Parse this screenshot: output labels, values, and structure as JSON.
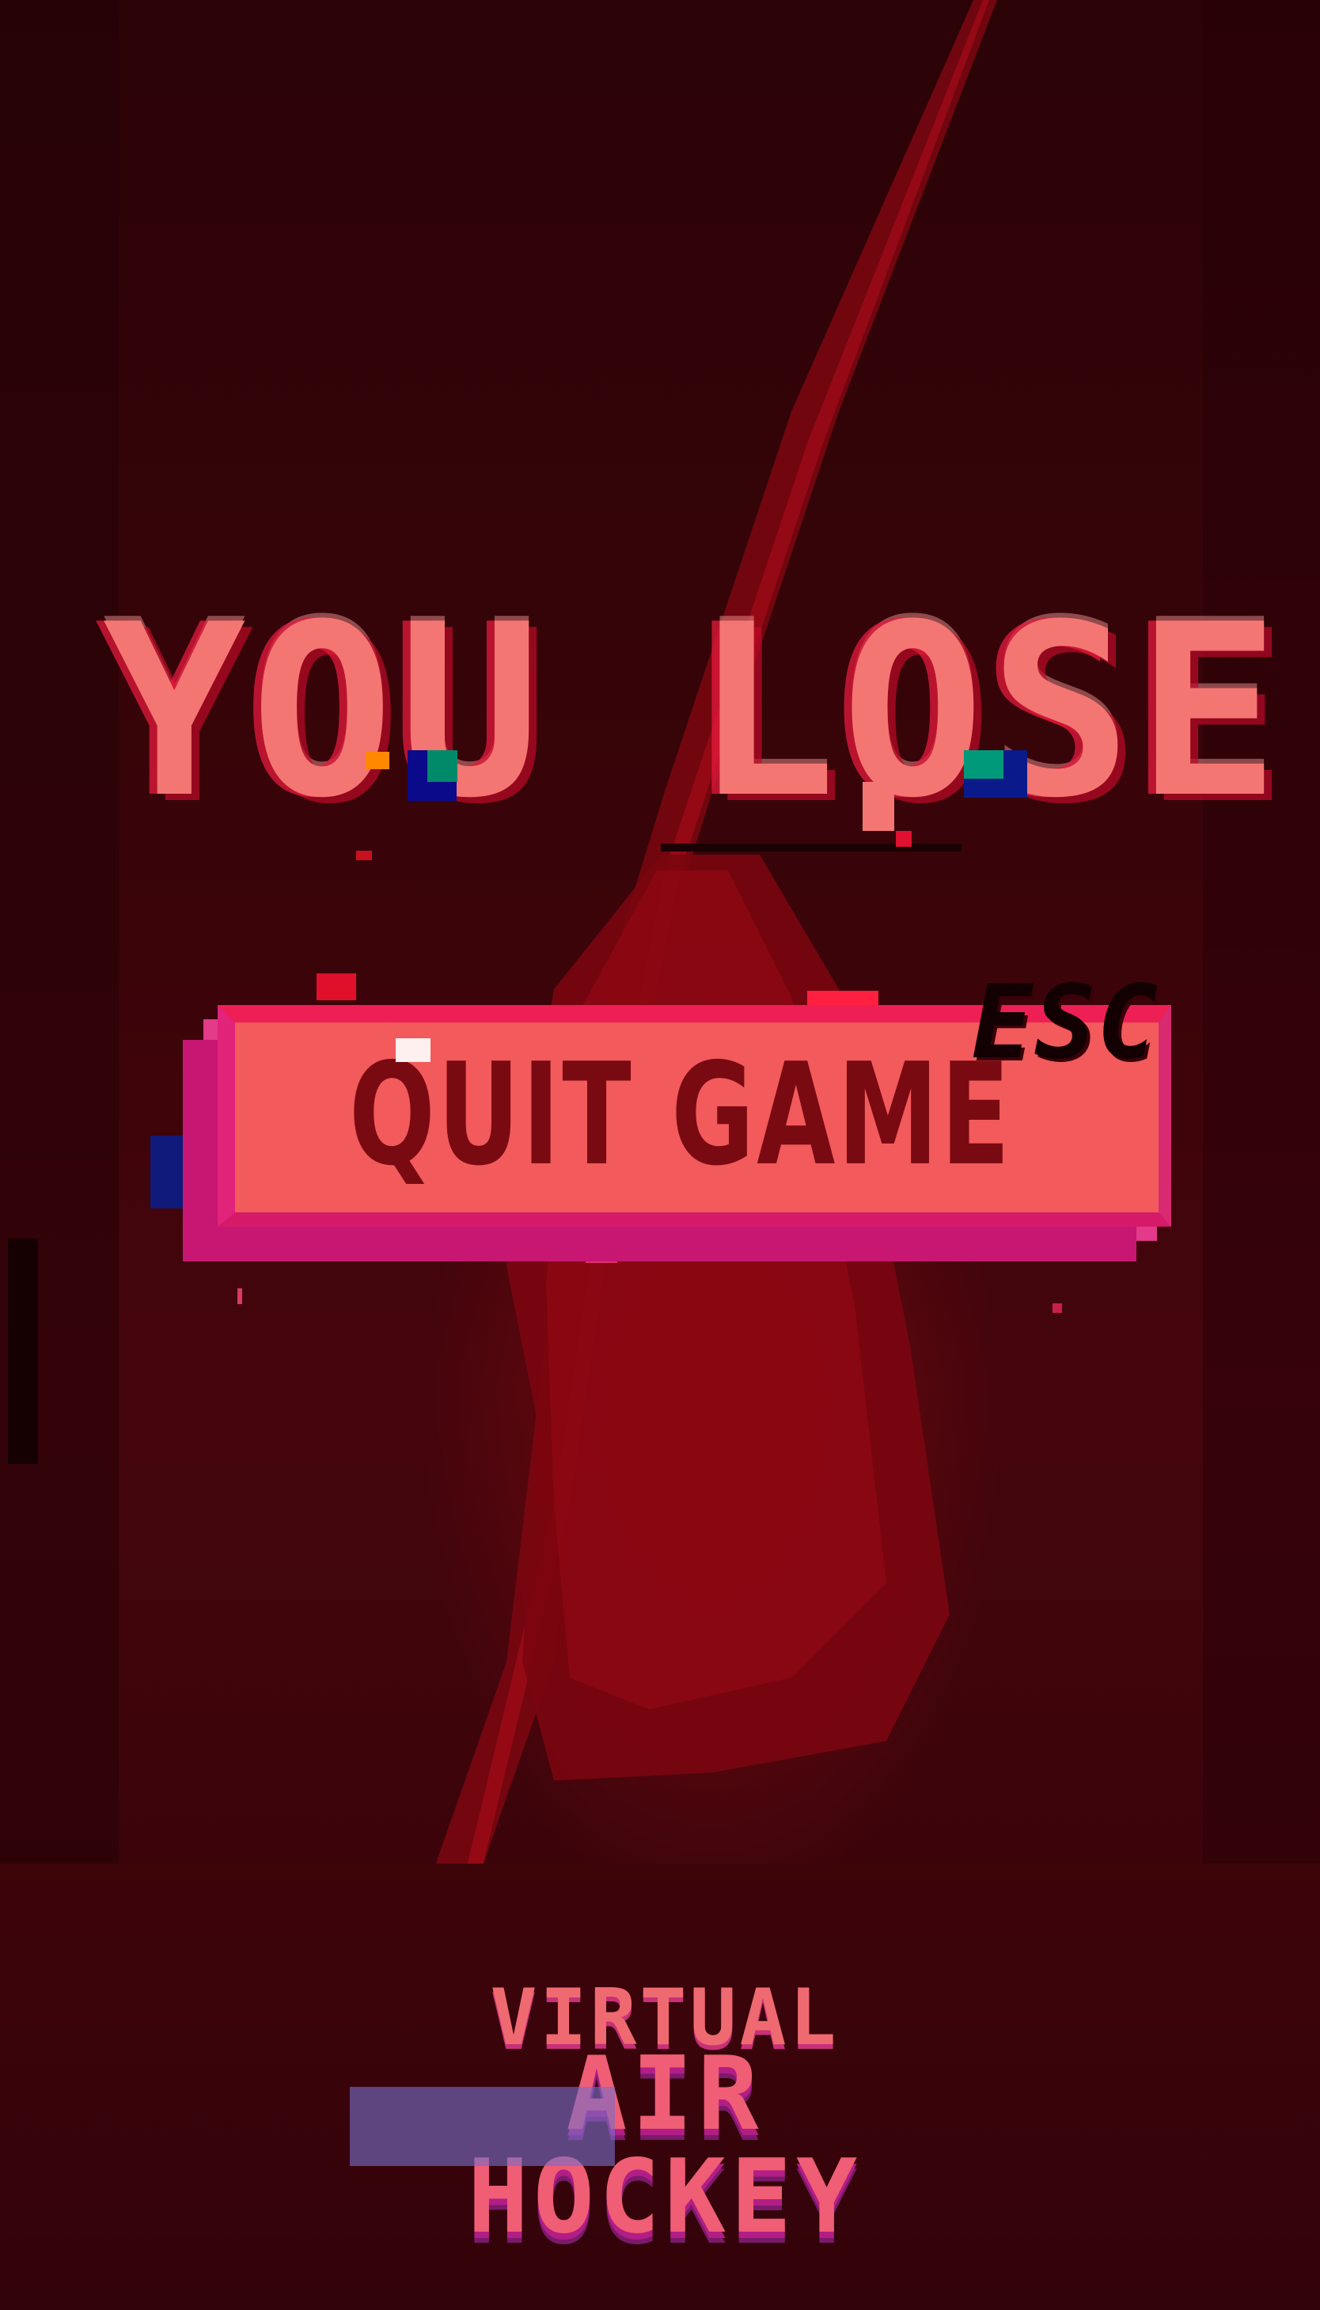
{
  "screen": {
    "title": "YOU LOSE",
    "quit_button_label": "QUIT GAME",
    "quit_shortcut": "ESC"
  },
  "logo": {
    "line1": "VIRTUAL",
    "line2": "AIR HOCKEY"
  },
  "colors": {
    "background": "#2a0206",
    "title": "#f47672",
    "button_face": "#f25a5b",
    "button_border": "#ee1f55",
    "button_text": "#7a0a12",
    "esc_text": "#120003",
    "logo_text": "#ef6a70"
  }
}
